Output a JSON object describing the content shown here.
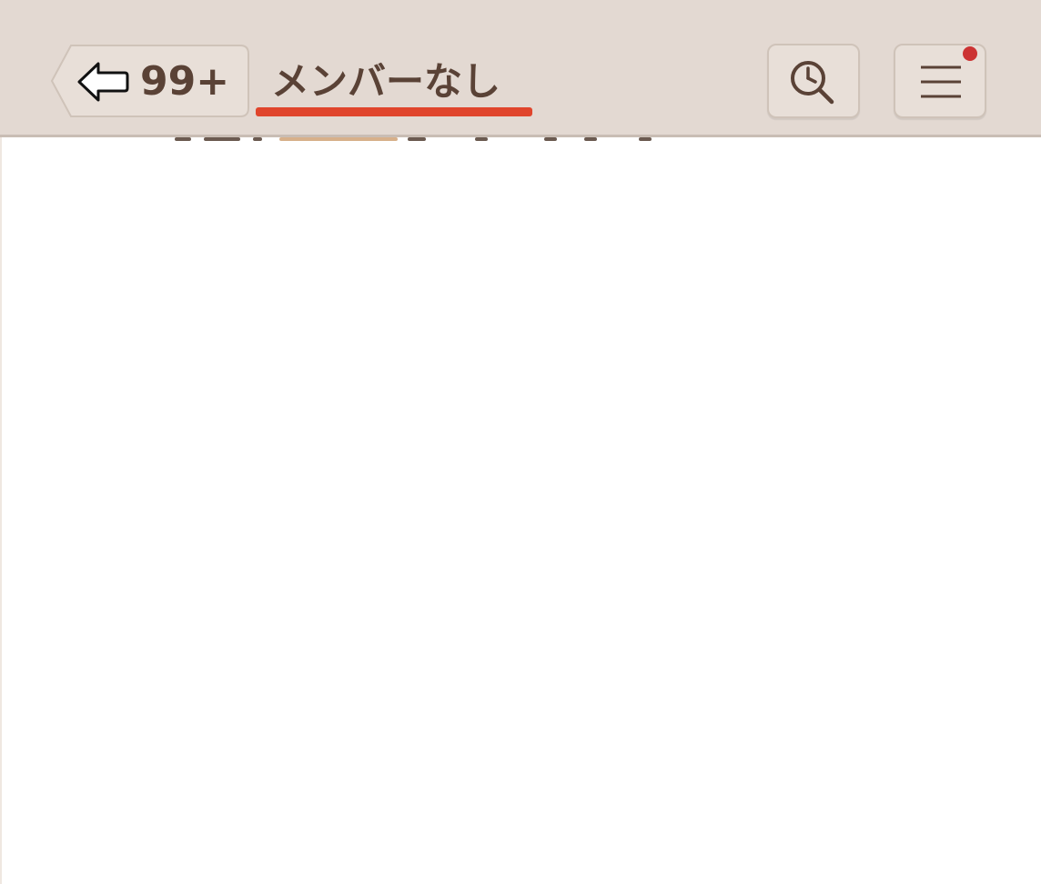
{
  "header": {
    "back_count": "99+",
    "title": "メンバーなし",
    "underline_color": "#e0452c",
    "background_color": "#e3d9d2",
    "text_color": "#5a4236"
  },
  "icons": {
    "back": "arrow-left-outline-icon",
    "history": "clock-search-icon",
    "menu": "hamburger-menu-icon",
    "notification": "notification-dot"
  },
  "notification_color": "#cc3333"
}
